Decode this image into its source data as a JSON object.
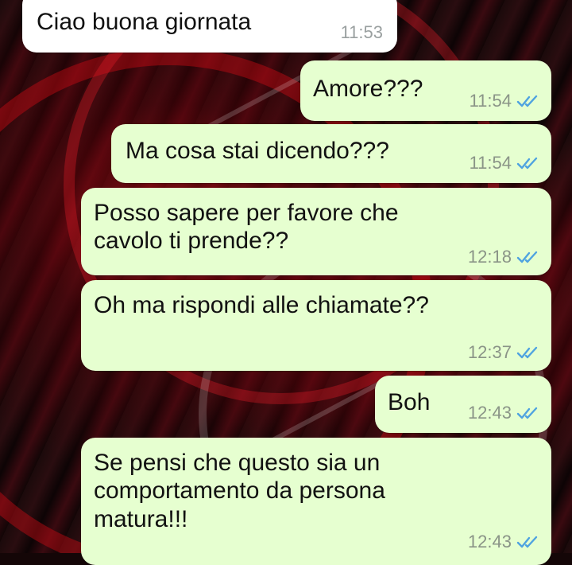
{
  "messages": [
    {
      "direction": "incoming",
      "text": "Ciao buona giornata",
      "time": "11:53"
    },
    {
      "direction": "outgoing",
      "text": "Amore???",
      "time": "11:54",
      "status": "read-double-check-icon"
    },
    {
      "direction": "outgoing",
      "text": "Ma cosa stai dicendo???",
      "time": "11:54",
      "status": "read-double-check-icon"
    },
    {
      "direction": "outgoing",
      "text": "Posso sapere per favore che cavolo ti prende??",
      "time": "12:18",
      "status": "read-double-check-icon"
    },
    {
      "direction": "outgoing",
      "text": "Oh ma rispondi alle chiamate??",
      "time": "12:37",
      "status": "read-double-check-icon"
    },
    {
      "direction": "outgoing",
      "text": "Boh",
      "time": "12:43",
      "status": "read-double-check-icon"
    },
    {
      "direction": "outgoing",
      "text": "Se pensi che questo sia un comportamento da persona matura!!!",
      "time": "12:43",
      "status": "read-double-check-icon"
    }
  ],
  "colors": {
    "incoming_bubble": "#ffffff",
    "outgoing_bubble": "#e6ffd0",
    "read_tick": "#4fa3e0",
    "timestamp": "#8a9487"
  }
}
